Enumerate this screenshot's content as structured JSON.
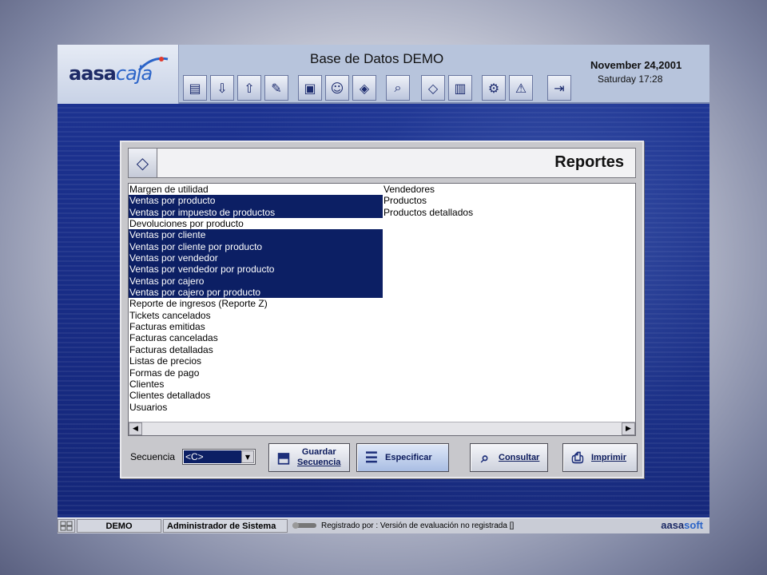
{
  "header": {
    "logo_main": "aasa",
    "logo_sub": "caja",
    "db_title": "Base de Datos DEMO",
    "date": "November 24,2001",
    "day_time": "Saturday  17:28",
    "toolbar_icons": [
      "cash-register-icon",
      "download-icon",
      "upload-icon",
      "tools-icon",
      "products-icon",
      "users-icon",
      "tag-icon",
      "search-doc-icon",
      "reports-icon",
      "books-icon",
      "settings-icon",
      "warning-settings-icon",
      "exit-door-icon"
    ]
  },
  "panel": {
    "title": "Reportes",
    "icon": "reports-icon",
    "list_col1": [
      {
        "label": "Margen de utilidad",
        "selected": false
      },
      {
        "label": "Ventas por producto",
        "selected": true
      },
      {
        "label": "Ventas por impuesto de productos",
        "selected": true
      },
      {
        "label": "Devoluciones por producto",
        "selected": false
      },
      {
        "label": "Ventas por cliente",
        "selected": true
      },
      {
        "label": "Ventas por cliente por producto",
        "selected": true
      },
      {
        "label": "Ventas por vendedor",
        "selected": true
      },
      {
        "label": "Ventas por vendedor por producto",
        "selected": true
      },
      {
        "label": "Ventas por cajero",
        "selected": true
      },
      {
        "label": "Ventas por cajero por producto",
        "selected": true
      },
      {
        "label": "Reporte de ingresos (Reporte Z)",
        "selected": false
      },
      {
        "label": "Tickets cancelados",
        "selected": false
      },
      {
        "label": "Facturas emitidas",
        "selected": false
      },
      {
        "label": "Facturas canceladas",
        "selected": false
      },
      {
        "label": "Facturas detalladas",
        "selected": false
      },
      {
        "label": "Listas de precios",
        "selected": false
      },
      {
        "label": "Formas de pago",
        "selected": false
      },
      {
        "label": "Clientes",
        "selected": false
      },
      {
        "label": "Clientes detallados",
        "selected": false
      },
      {
        "label": "Usuarios",
        "selected": false
      }
    ],
    "list_col2": [
      {
        "label": "Vendedores",
        "selected": false
      },
      {
        "label": "Productos",
        "selected": false
      },
      {
        "label": "Productos detallados",
        "selected": false
      }
    ],
    "sequence_label": "Secuencia",
    "sequence_value": "<C>",
    "buttons": {
      "guardar_line1": "Guardar",
      "guardar_line2": "Secuencia",
      "especificar": "Especificar",
      "consultar": "Consultar",
      "imprimir": "Imprimir"
    }
  },
  "status": {
    "db": "DEMO",
    "user": "Administrador de Sistema",
    "registration": "Registrado por : Versión de evaluación no registrada  []",
    "brand_main": "aasa",
    "brand_sub": "soft"
  },
  "colors": {
    "selection": "#0c1f64",
    "header_bg": "#b7c4dc",
    "background_blue": "#1a2f86"
  }
}
